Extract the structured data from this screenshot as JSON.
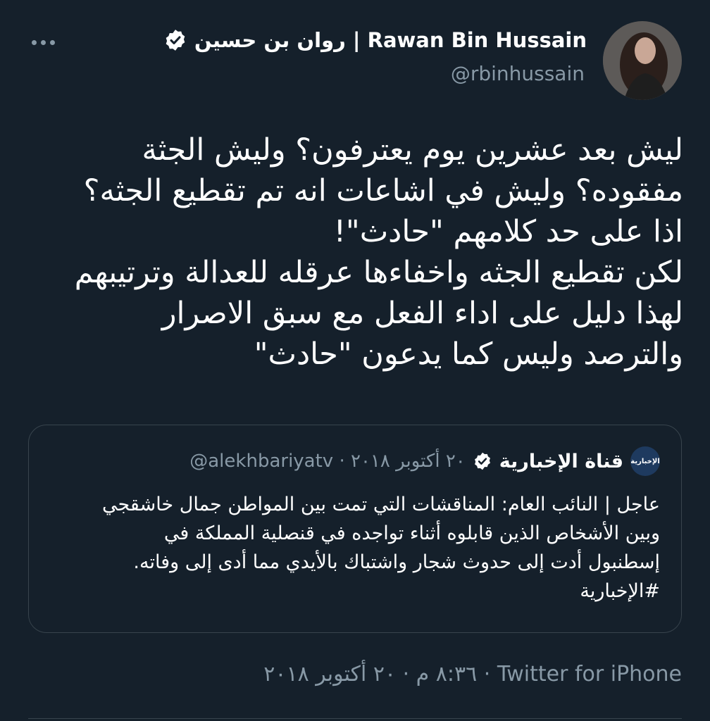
{
  "tweet": {
    "author_name": "روان بن حسين | Rawan Bin Hussain",
    "handle": "@rbinhussain",
    "text": "ليش بعد عشرين يوم يعترفون؟ وليش الجثة\nمفقوده؟ وليش في اشاعات انه تم تقطيع الجثه؟\nاذا على حد كلامهم \"حادث\"!\nلكن تقطيع الجثه واخفاءها عرقله للعدالة وترتيبهم\nلهذا دليل على اداء الفعل مع سبق الاصرار\nوالترصد وليس كما يدعون \"حادث\"",
    "footer": "٨:٣٦ م · ٢٠ أكتوبر ٢٠١٨ · Twitter for iPhone"
  },
  "quoted_tweet": {
    "avatar_text": "الإخبارية",
    "author_name": "قناة الإخبارية",
    "meta": "@alekhbariyatv · ٢٠ أكتوبر ٢٠١٨",
    "text": "عاجل | النائب العام: المناقشات التي تمت بين المواطن جمال خاشقجي\nوبين الأشخاص الذين قابلوه أثناء تواجده في قنصلية المملكة في\nإسطنبول أدت إلى حدوث شجار واشتباك بالأيدي مما أدى إلى وفاته.\n#الإخبارية"
  },
  "icons": {
    "more": "more-horizontal-icon",
    "verified": "verified-badge-icon"
  },
  "colors": {
    "background": "#15202b",
    "secondary_text": "#8899a6",
    "border": "#38444d"
  }
}
